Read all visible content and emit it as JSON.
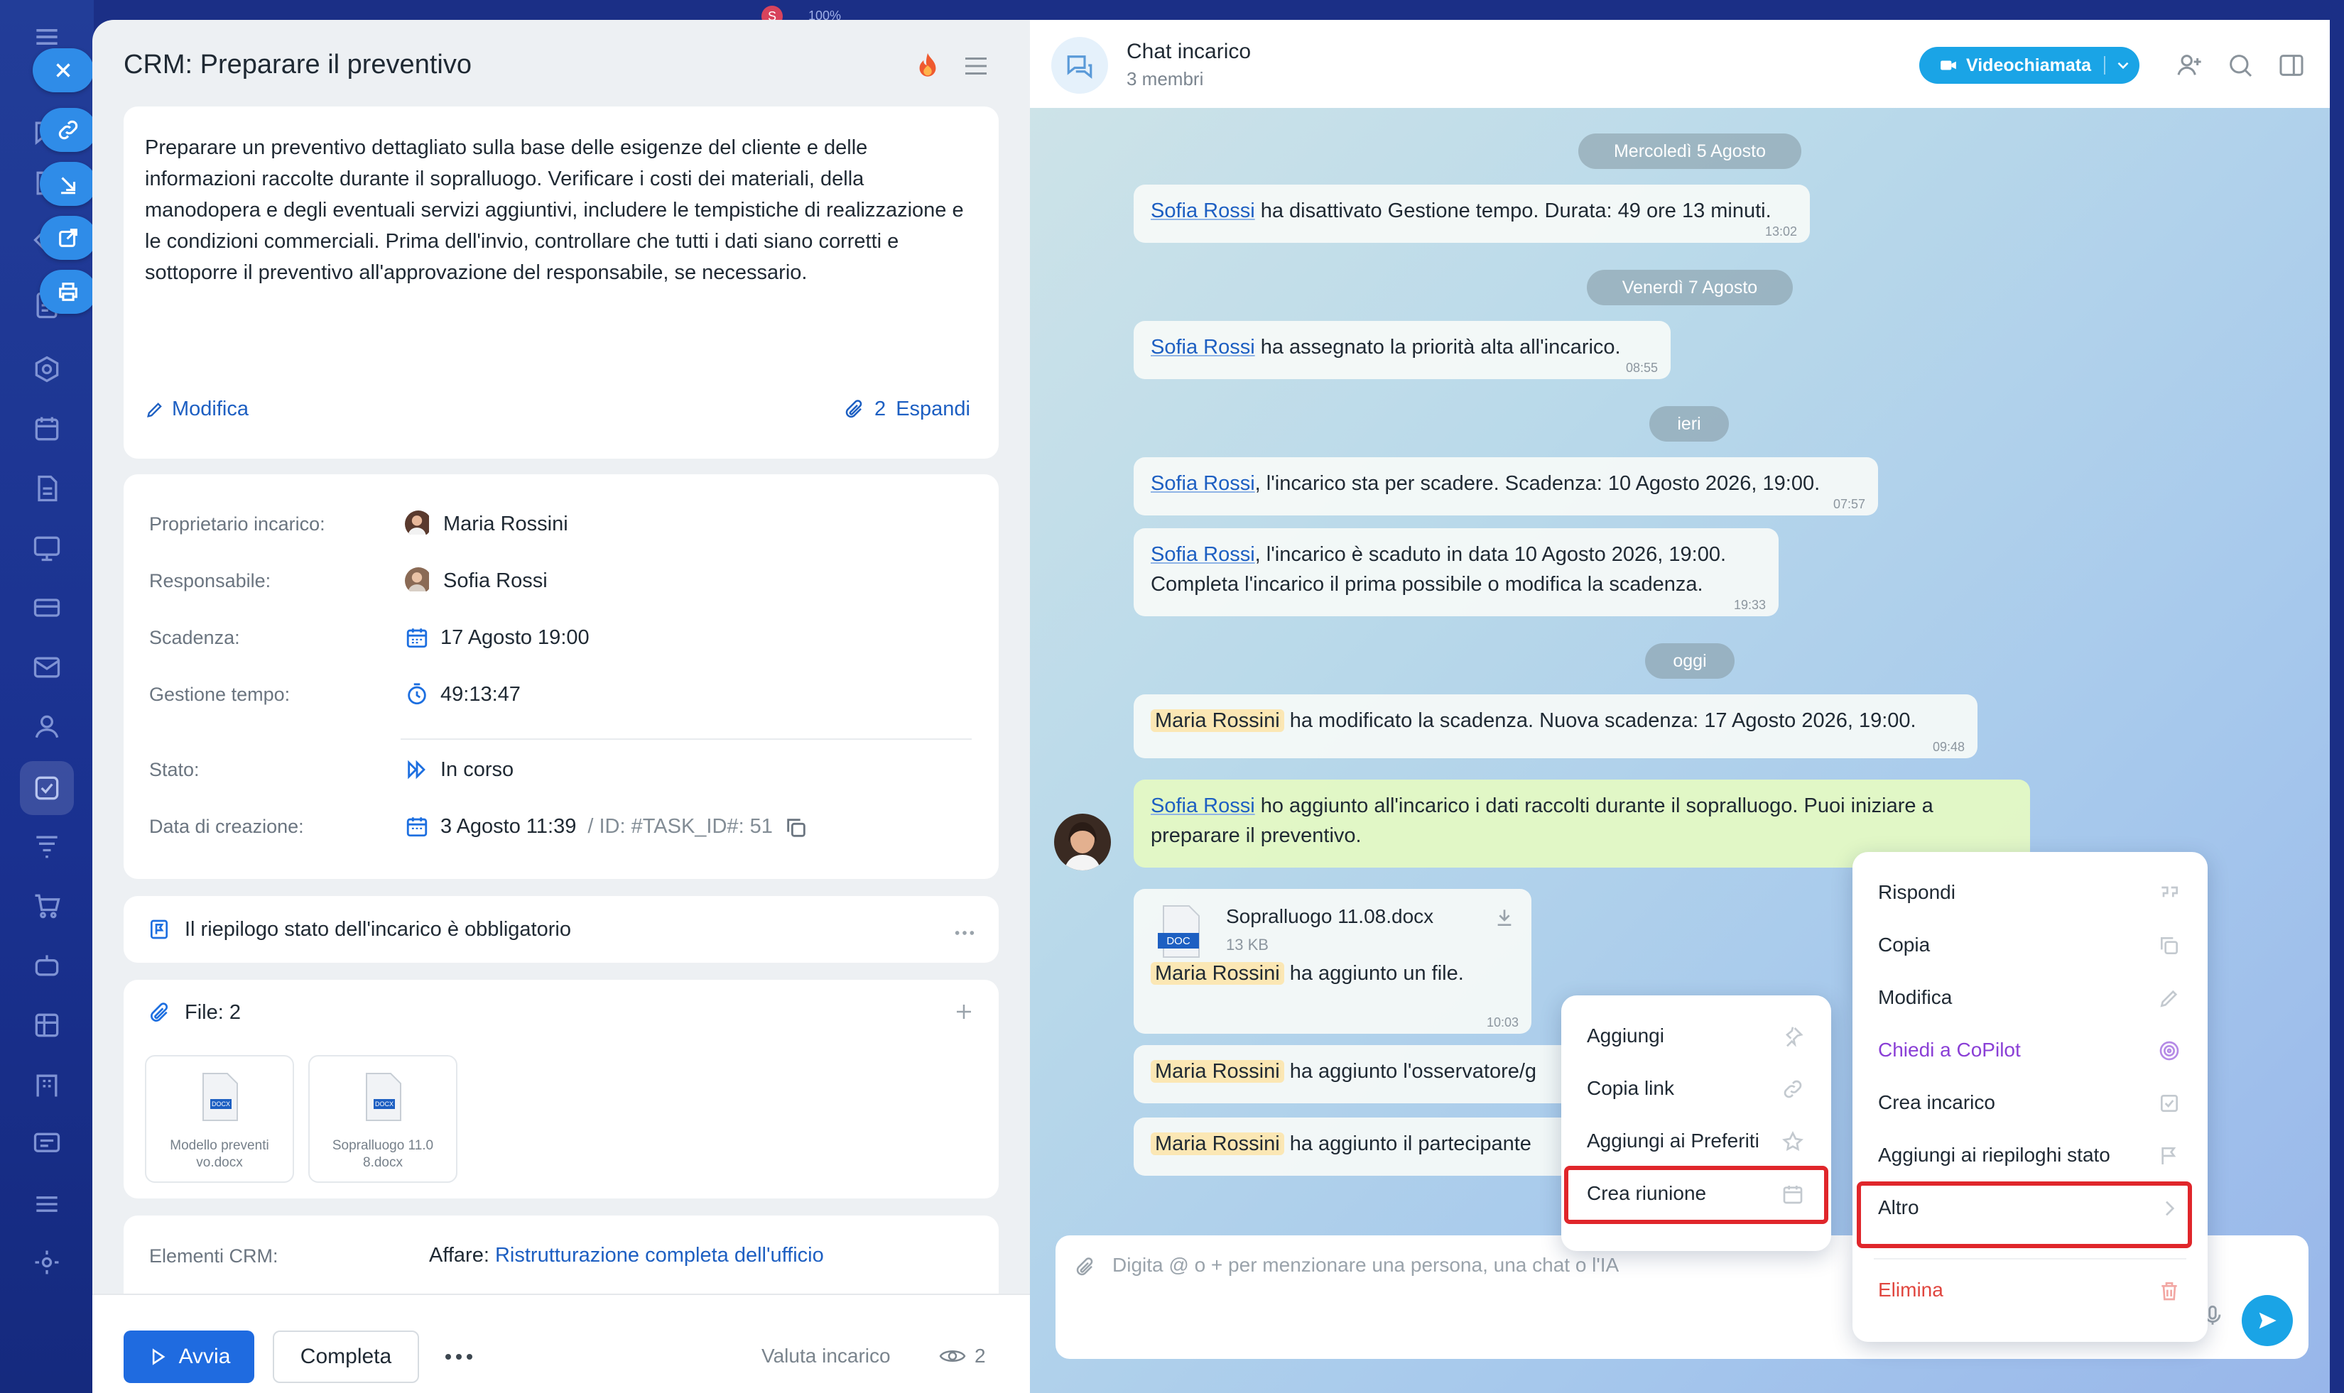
{
  "topbar": {
    "avatar_initial": "S",
    "zoom": "100%"
  },
  "task": {
    "title": "CRM: Preparare il preventivo",
    "description": "Preparare un preventivo dettagliato sulla base delle esigenze del cliente e delle informazioni raccolte durante il sopralluogo. Verificare i costi dei materiali, della manodopera e degli eventuali servizi aggiuntivi, includere le tempistiche di realizzazione e le condizioni commerciali. Prima dell'invio, controllare che tutti i dati siano corretti e sottoporre il preventivo all'approvazione del responsabile, se necessario.",
    "edit_label": "Modifica",
    "attachments_count": "2",
    "expand_label": "Espandi",
    "info": {
      "owner_label": "Proprietario incarico:",
      "owner": "Maria Rossini",
      "assignee_label": "Responsabile:",
      "assignee": "Sofia Rossi",
      "deadline_label": "Scadenza:",
      "deadline": "17 Agosto 19:00",
      "time_label": "Gestione tempo:",
      "time": "49:13:47",
      "status_label": "Stato:",
      "status": "In corso",
      "created_label": "Data di creazione:",
      "created": "3 Agosto 11:39",
      "task_id": "/ ID: #TASK_ID#: 51"
    },
    "summary_required": "Il riepilogo stato dell'incarico è obbligatorio",
    "files_label": "File: 2",
    "files": [
      {
        "name": "Modello preventi vo.docx",
        "badge": "DOCX"
      },
      {
        "name": "Sopralluogo 11.0 8.docx",
        "badge": "DOCX"
      }
    ],
    "crm_label": "Elementi CRM:",
    "crm_prefix": "Affare:",
    "crm_link": "Ristrutturazione completa dell'ufficio",
    "footer": {
      "start": "Avvia",
      "complete": "Completa",
      "rate": "Valuta incarico",
      "views": "2"
    }
  },
  "chat": {
    "title": "Chat incarico",
    "members": "3 membri",
    "video_button": "Videochiamata",
    "dates": [
      "Mercoledì 5 Agosto",
      "Venerdì 7 Agosto",
      "ieri",
      "oggi"
    ],
    "messages": [
      {
        "mention": "Sofia Rossi",
        "text": " ha disattivato Gestione tempo. Durata: 49 ore 13 minuti.",
        "time": "13:02"
      },
      {
        "mention": "Sofia Rossi",
        "text": " ha assegnato la priorità alta all'incarico.",
        "time": "08:55"
      },
      {
        "mention": "Sofia Rossi",
        "text": ", l'incarico sta per scadere. Scadenza: 10 Agosto 2026, 19:00.",
        "time": "07:57"
      },
      {
        "mention": "Sofia Rossi",
        "text": ", l'incarico è scaduto in data 10 Agosto 2026, 19:00.",
        "text2": "Completa l'incarico il prima possibile o modifica la scadenza.",
        "time": "19:33"
      },
      {
        "mention": "Maria Rossini",
        "text": " ha modificato la scadenza. Nuova scadenza: 17 Agosto 2026, 19:00.",
        "time": "09:48"
      },
      {
        "mention": "Sofia Rossi",
        "text": " ho aggiunto all'incarico i dati raccolti durante il sopralluogo. Puoi iniziare a preparare il preventivo."
      },
      {
        "mention": "Maria Rossini",
        "text": " ha aggiunto l'osservatore/g"
      },
      {
        "mention": "Maria Rossini",
        "text": " ha aggiunto il partecipante"
      }
    ],
    "file_message": {
      "name": "Sopralluogo 11.08.docx",
      "size": "13 KB",
      "badge": "DOC",
      "mention": "Maria Rossini",
      "text": " ha aggiunto un file.",
      "time": "10:03"
    },
    "composer_placeholder": "Digita @ o + per menzionare una persona, una chat o l'IA"
  },
  "menu_main": [
    "Rispondi",
    "Copia",
    "Modifica",
    "Chiedi a CoPilot",
    "Crea incarico",
    "Aggiungi ai riepiloghi stato",
    "Altro",
    "Elimina"
  ],
  "menu_sub": [
    "Aggiungi",
    "Copia link",
    "Aggiungi ai Preferiti",
    "Crea riunione"
  ],
  "colors": {
    "accent": "#1f6be0",
    "link": "#1d5fc2",
    "highlight": "#e0262b",
    "copilot": "#8a3fd6",
    "danger": "#e0463f"
  }
}
